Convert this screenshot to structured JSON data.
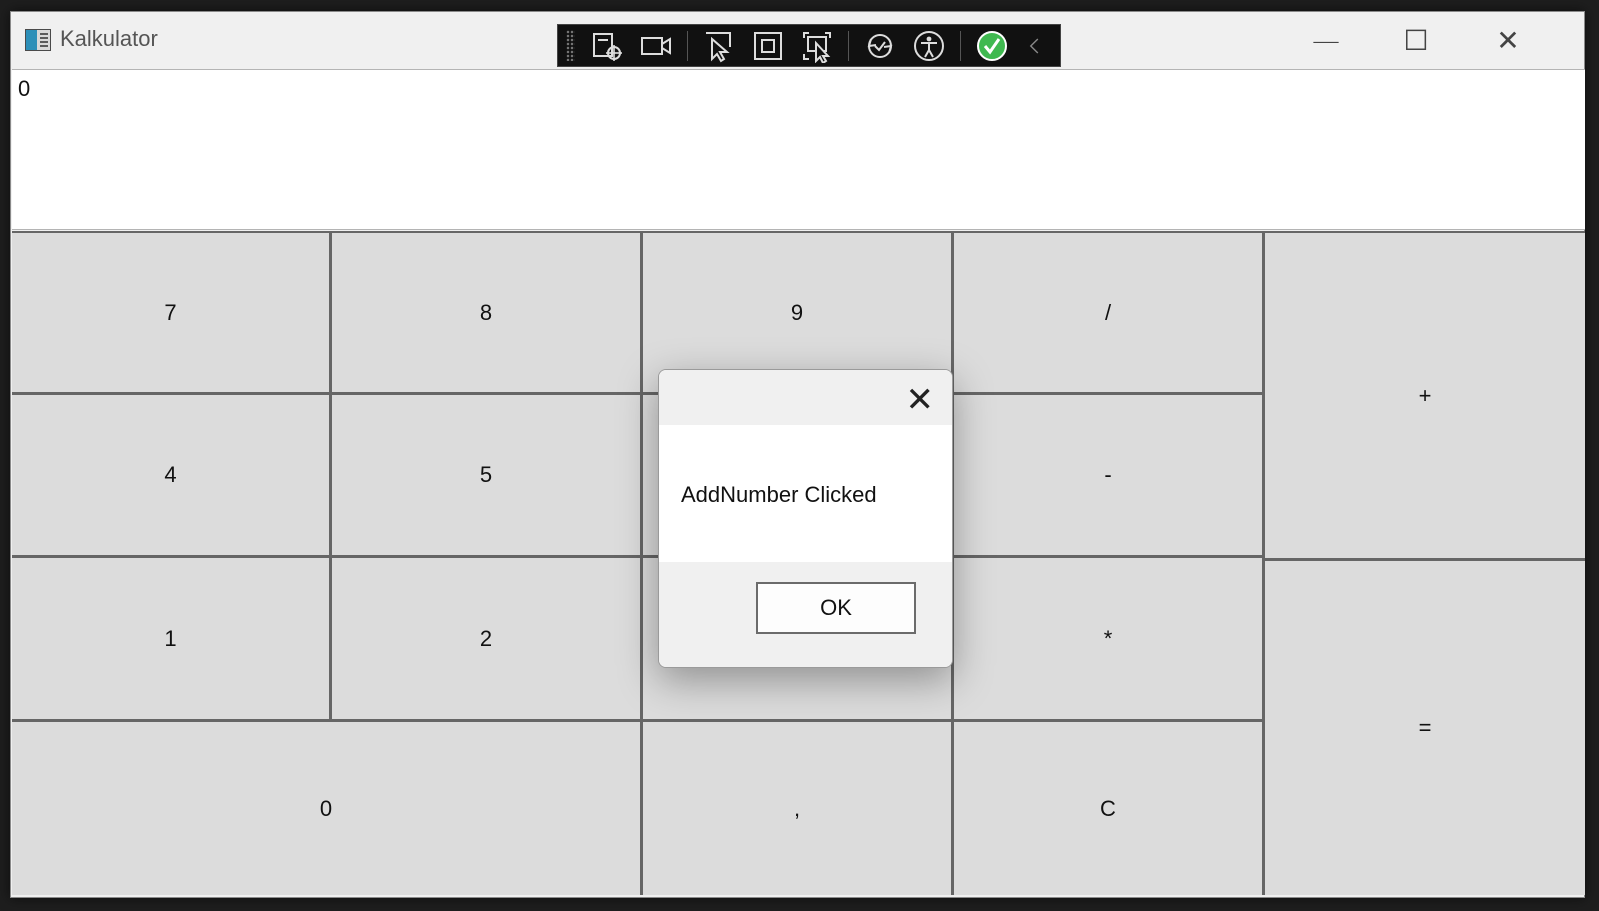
{
  "window": {
    "title": "Kalkulator",
    "app_icon": "calculator-app-icon"
  },
  "window_controls": {
    "minimize": "—",
    "maximize": "☐",
    "close": "✕"
  },
  "toolbar": {
    "icons": [
      "select-element-icon",
      "video-record-icon",
      "pointer-select-icon",
      "element-bounds-icon",
      "track-focus-icon",
      "hot-reload-icon",
      "accessibility-icon",
      "checkmark-icon",
      "chevron-left-icon"
    ]
  },
  "display": {
    "value": "0"
  },
  "keys": {
    "seven": "7",
    "eight": "8",
    "nine": "9",
    "divide": "/",
    "plus": "+",
    "four": "4",
    "five": "5",
    "minus": "-",
    "one": "1",
    "two": "2",
    "multiply": "*",
    "equals": "=",
    "zero": "0",
    "comma": ",",
    "clear": "C"
  },
  "dialog": {
    "close": "✕",
    "message": "AddNumber Clicked",
    "ok_label": "OK"
  },
  "colors": {
    "accent_check": "#3fb950",
    "key_bg": "#dcdcdc",
    "grid_line": "#666666"
  }
}
